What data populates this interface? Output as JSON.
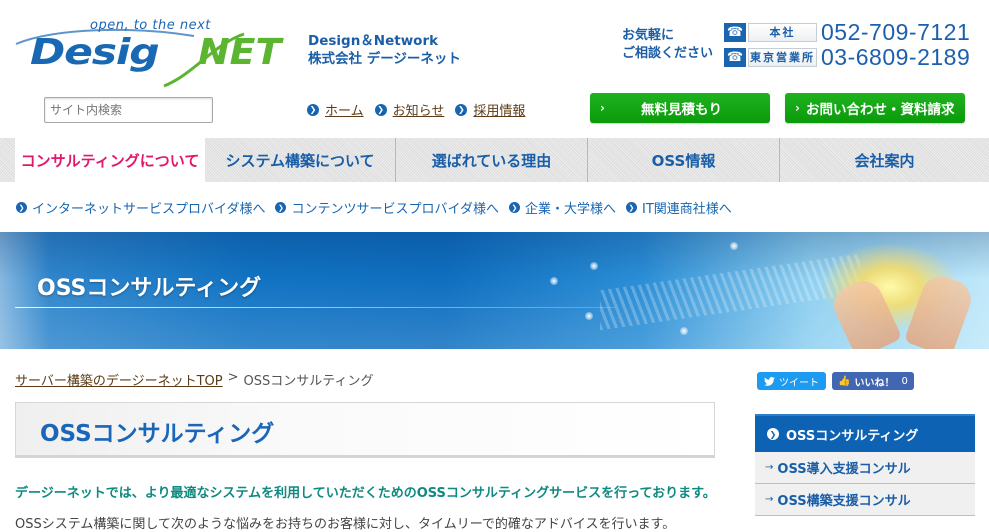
{
  "header": {
    "logo": {
      "tagline": "open, to the next",
      "name_part1": "Desig",
      "name_part2": "NET"
    },
    "company": {
      "line1": "Design＆Network",
      "line2": "株式会社 デージーネット"
    },
    "contact": {
      "label_line1": "お気軽に",
      "label_line2": "ご相談ください",
      "phones": [
        {
          "icon": "phone-icon",
          "office": "本社",
          "number": "052-709-7121"
        },
        {
          "icon": "phone-icon",
          "office": "東京営業所",
          "number": "03-6809-2189"
        }
      ]
    }
  },
  "search": {
    "placeholder": "サイト内検索",
    "value": ""
  },
  "util_nav": [
    {
      "label": "ホーム"
    },
    {
      "label": "お知らせ"
    },
    {
      "label": "採用情報"
    }
  ],
  "buttons": {
    "estimate": "無料見積もり",
    "contact": "お問い合わせ・資料請求",
    "chevron": "›"
  },
  "global_nav": [
    {
      "label": "コンサルティングについて",
      "active": true
    },
    {
      "label": "システム構築について",
      "active": false
    },
    {
      "label": "選ばれている理由",
      "active": false
    },
    {
      "label": "OSS情報",
      "active": false
    },
    {
      "label": "会社案内",
      "active": false
    }
  ],
  "sub_nav": [
    {
      "label": "インターネットサービスプロバイダ様へ"
    },
    {
      "label": "コンテンツサービスプロバイダ様へ"
    },
    {
      "label": "企業・大学様へ"
    },
    {
      "label": "IT関連商社様へ"
    }
  ],
  "banner": {
    "title": "OSSコンサルティング"
  },
  "breadcrumb": {
    "home_link": "サーバー構築のデージーネットTOP",
    "separator": ">",
    "current": "OSSコンサルティング"
  },
  "main": {
    "title": "OSSコンサルティング",
    "lead": "デージーネットでは、より最適なシステムを利用していただくためのOSSコンサルティングサービスを行っております。",
    "body": "OSSシステム構築に関して次のような悩みをお持ちのお客様に対し、タイムリーで的確なアドバイスを行います。"
  },
  "social": {
    "tweet_label": "ツイート",
    "like_label": "いいね！",
    "like_count": "0"
  },
  "sidebar": {
    "heading": "OSSコンサルティング",
    "items": [
      {
        "label": "OSS導入支援コンサル"
      },
      {
        "label": "OSS構築支援コンサル"
      }
    ]
  },
  "colors": {
    "brand_blue": "#1a64b0",
    "brand_green": "#5cb531",
    "active_nav": "#e0176c",
    "cta_green": "#11a611",
    "lead_teal": "#0e8a80",
    "link_brown": "#5c3b16"
  }
}
